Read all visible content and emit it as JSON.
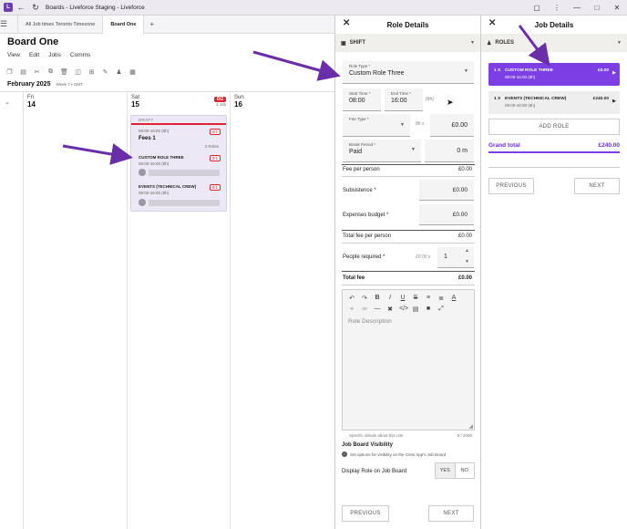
{
  "window": {
    "title": "Boards - Liveforce Staging - Liveforce",
    "logo_glyph": "L"
  },
  "tabs": [
    {
      "label": "All Job times Toronto Timezone"
    },
    {
      "label": "Board One"
    }
  ],
  "board": {
    "title": "Board One",
    "menu": [
      "View",
      "Edit",
      "Jobs",
      "Comms"
    ],
    "month": "February 2025",
    "week_info": "Week 7 • GMT"
  },
  "calendar": {
    "days": [
      {
        "name": "Fri",
        "num": "14"
      },
      {
        "name": "Sat",
        "num": "15",
        "badge": "0/2",
        "jobs": "1 Job"
      },
      {
        "name": "Sun",
        "num": "16"
      }
    ],
    "job": {
      "status": "DRAFT",
      "time": "08:00-16:00 (8h)",
      "badge": "0/2",
      "title": "Fees 1",
      "roles_count": "2 Roles",
      "roles": [
        {
          "title": "CUSTOM ROLE THREE",
          "time": "08:00-16:00 (8h)",
          "badge": "0/1"
        },
        {
          "title": "EVENTS (TECHNICAL CREW)",
          "time": "08:00-16:00 (8h)",
          "badge": "0/1"
        }
      ]
    }
  },
  "role_details": {
    "title": "Role Details",
    "section": "SHIFT",
    "role_type_label": "Role Type *",
    "role_type_value": "Custom Role Three",
    "start_time_label": "Start Time *",
    "start_time_value": "08:00",
    "end_time_label": "End Time *",
    "end_time_value": "16:00",
    "duration": "(8h)",
    "fee_type_label": "Fee Type *",
    "fee_rate_hint": "8h x",
    "fee_type_amount": "£0.00",
    "break_period_label": "Break Period *",
    "break_period_value": "Paid",
    "break_minutes": "0 m",
    "fee_per_person_label": "Fee per person",
    "fee_per_person_value": "£0.00",
    "subsistence_label": "Subsistence *",
    "subsistence_value": "£0.00",
    "expenses_label": "Expenses budget *",
    "expenses_value": "£0.00",
    "total_fee_person_label": "Total fee per person",
    "total_fee_person_value": "£0.00",
    "people_required_label": "People required *",
    "people_rate_hint": "£0.00 x",
    "people_required_value": "1",
    "total_fee_label": "Total fee",
    "total_fee_value": "£0.00",
    "description_placeholder": "Role Description",
    "description_hint": "Specific details about this role",
    "char_count": "0 / 2000",
    "visibility_title": "Job Board Visibility",
    "visibility_info": "Set options for visibility on the Crew App's Job Board",
    "display_role_label": "Display Role on Job Board",
    "yes_label": "YES",
    "no_label": "NO",
    "previous_label": "PREVIOUS",
    "next_label": "NEXT"
  },
  "job_details": {
    "title": "Job Details",
    "section": "ROLES",
    "roles": [
      {
        "qty": "1 X",
        "name": "CUSTOM ROLE THREE",
        "time": "08:00-16:00 (8h)",
        "price": "£0.00"
      },
      {
        "qty": "1 X",
        "name": "EVENTS (TECHNICAL CREW)",
        "time": "08:00-16:00 (8h)",
        "price": "£240.00"
      }
    ],
    "add_role_label": "ADD ROLE",
    "grand_total_label": "Grand total",
    "grand_total_value": "£240.00",
    "previous_label": "PREVIOUS",
    "next_label": "NEXT"
  },
  "colors": {
    "accent": "#7b3fe4",
    "alert": "#e02433",
    "arrow": "#6a2fa8"
  }
}
